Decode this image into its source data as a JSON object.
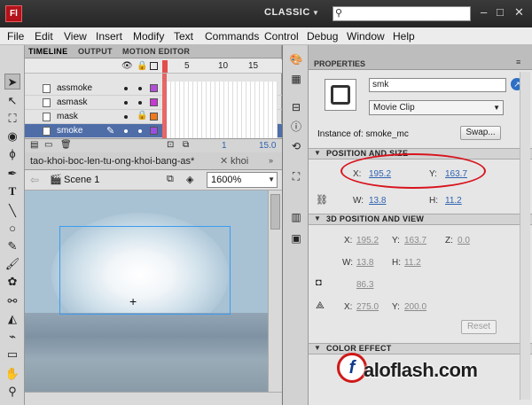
{
  "app": {
    "logo": "Fl",
    "workspace": "CLASSIC"
  },
  "menu": [
    "File",
    "Edit",
    "View",
    "Insert",
    "Modify",
    "Text",
    "Commands",
    "Control",
    "Debug",
    "Window",
    "Help"
  ],
  "timeline": {
    "tabs": [
      "TIMELINE",
      "OUTPUT",
      "MOTION EDITOR"
    ],
    "frame_numbers": [
      "5",
      "10",
      "15"
    ],
    "layers": [
      {
        "name": "assmoke",
        "color": "#b04fd6"
      },
      {
        "name": "asmask",
        "color": "#c63ad0"
      },
      {
        "name": "mask",
        "color": "#f07a1a"
      },
      {
        "name": "smoke",
        "color": "#9a4fe0",
        "selected": true
      }
    ],
    "current_frame": "1",
    "fps": "15.0"
  },
  "document": {
    "tab_active": "tao-khoi-boc-len-tu-ong-khoi-bang-as*",
    "tab_other": "khoi",
    "scene": "Scene 1",
    "zoom": "1600%"
  },
  "properties": {
    "title": "PROPERTIES",
    "instance_name": "smk",
    "symbol_type": "Movie Clip",
    "instance_of_label": "Instance of:",
    "instance_of_value": "smoke_mc",
    "swap_label": "Swap...",
    "sections": {
      "position_size": "POSITION AND SIZE",
      "position_3d": "3D POSITION AND VIEW",
      "color_effect": "COLOR EFFECT"
    },
    "pos": {
      "x_label": "X:",
      "x": "195.2",
      "y_label": "Y:",
      "y": "163.7",
      "w_label": "W:",
      "w": "13.8",
      "h_label": "H:",
      "h": "11.2"
    },
    "pos3d": {
      "x": "195.2",
      "y": "163.7",
      "z": "0.0",
      "w": "13.8",
      "h": "11.2",
      "persp": "86.3",
      "vx": "275.0",
      "vy": "200.0",
      "z_label": "Z:"
    },
    "reset_label": "Reset"
  },
  "watermark": {
    "text": "aloflash.com",
    "logo_letter": "f"
  }
}
